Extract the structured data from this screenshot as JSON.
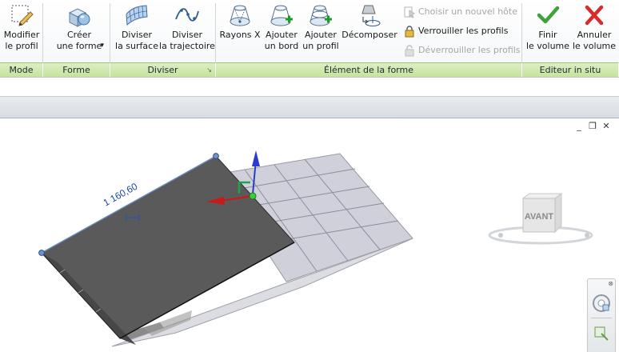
{
  "ribbon": {
    "panels": {
      "mode": "Mode",
      "forme": "Forme",
      "diviser": "Diviser",
      "element": "Élément de la forme",
      "editeur": "Editeur in situ"
    },
    "buttons": {
      "modifier": "Modifier\nle profil",
      "creer": "Créer\nune forme",
      "diviser_surface": "Diviser\nla surface",
      "diviser_trajectoire": "Diviser\nla trajectoire",
      "rayons_x": "Rayons X",
      "ajouter_bord": "Ajouter\nun bord",
      "ajouter_profil": "Ajouter\nun profil",
      "decomposer": "Décomposer",
      "finir": "Finir\nle volume",
      "annuler": "Annuler\nle volume"
    },
    "small_buttons": {
      "choisir_hote": "Choisir un nouvel hôte",
      "verrouiller": "Verrouiller les profils",
      "deverrouiller": "Déverrouiller les profils"
    },
    "dropdown_arrow": "▾",
    "launcher": "↘"
  },
  "viewport": {
    "dimension_value": "1 160,60",
    "viewcube_face": "AVANT",
    "window_controls": [
      "_",
      "❐",
      "✕"
    ]
  },
  "icons": {
    "modifier": "edit-profile-icon",
    "creer": "create-form-icon",
    "diviser_surface": "divide-surface-icon",
    "diviser_trajectoire": "divide-path-icon",
    "rayons_x": "xray-icon",
    "ajouter_bord": "add-edge-icon",
    "ajouter_profil": "add-profile-icon",
    "decomposer": "dissolve-icon",
    "finir": "check-icon",
    "annuler": "cross-icon"
  },
  "colors": {
    "panel_label_green": "#c6e39c",
    "finish_green": "#3ea33a",
    "cancel_red": "#d92b2b",
    "dimension_blue": "#1b4aa8",
    "solid_face": "#5a5a5a",
    "grid_face": "#cfd0da"
  }
}
